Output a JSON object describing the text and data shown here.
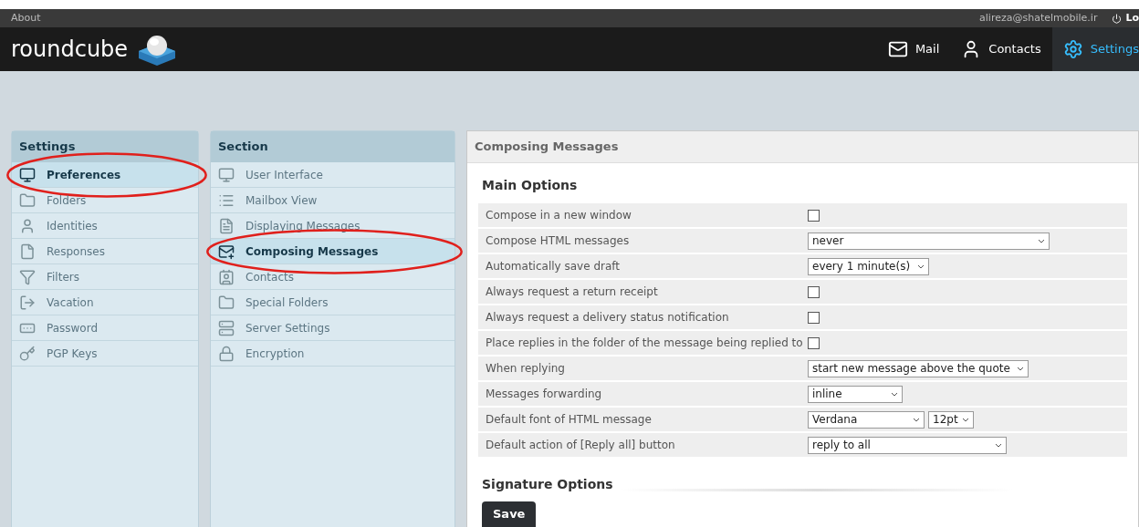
{
  "topbar": {
    "about": "About",
    "user": "alireza@shatelmobile.ir",
    "logout": "Lo"
  },
  "header": {
    "logo": "roundcube",
    "nav": [
      {
        "label": "Mail",
        "selected": false
      },
      {
        "label": "Contacts",
        "selected": false
      },
      {
        "label": "Settings",
        "selected": true
      }
    ]
  },
  "settings_panel": {
    "title": "Settings",
    "items": [
      {
        "label": "Preferences",
        "selected": true,
        "circled": true
      },
      {
        "label": "Folders",
        "selected": false,
        "circled": false
      },
      {
        "label": "Identities",
        "selected": false,
        "circled": false
      },
      {
        "label": "Responses",
        "selected": false,
        "circled": false
      },
      {
        "label": "Filters",
        "selected": false,
        "circled": false
      },
      {
        "label": "Vacation",
        "selected": false,
        "circled": false
      },
      {
        "label": "Password",
        "selected": false,
        "circled": false
      },
      {
        "label": "PGP Keys",
        "selected": false,
        "circled": false
      }
    ]
  },
  "section_panel": {
    "title": "Section",
    "items": [
      {
        "label": "User Interface",
        "selected": false,
        "circled": false
      },
      {
        "label": "Mailbox View",
        "selected": false,
        "circled": false
      },
      {
        "label": "Displaying Messages",
        "selected": false,
        "circled": false
      },
      {
        "label": "Composing Messages",
        "selected": true,
        "circled": true
      },
      {
        "label": "Contacts",
        "selected": false,
        "circled": false
      },
      {
        "label": "Special Folders",
        "selected": false,
        "circled": false
      },
      {
        "label": "Server Settings",
        "selected": false,
        "circled": false
      },
      {
        "label": "Encryption",
        "selected": false,
        "circled": false
      }
    ]
  },
  "content": {
    "title": "Composing Messages",
    "main_heading": "Main Options",
    "options": [
      {
        "label": "Compose in a new window",
        "kind": "checkbox",
        "checked": false
      },
      {
        "label": "Compose HTML messages",
        "kind": "select",
        "value": "never"
      },
      {
        "label": "Automatically save draft",
        "kind": "select",
        "value": "every 1 minute(s)"
      },
      {
        "label": "Always request a return receipt",
        "kind": "checkbox",
        "checked": false
      },
      {
        "label": "Always request a delivery status notification",
        "kind": "checkbox",
        "checked": false
      },
      {
        "label": "Place replies in the folder of the message being replied to",
        "kind": "checkbox",
        "checked": false
      },
      {
        "label": "When replying",
        "kind": "select",
        "value": "start new message above the quote"
      },
      {
        "label": "Messages forwarding",
        "kind": "select",
        "value": "inline"
      },
      {
        "label": "Default font of HTML message",
        "kind": "select_pair",
        "value": "Verdana",
        "value_2": "12pt"
      },
      {
        "label": "Default action of [Reply all] button",
        "kind": "select",
        "value": "reply to all"
      }
    ],
    "signature_heading": "Signature Options",
    "save": "Save"
  }
}
